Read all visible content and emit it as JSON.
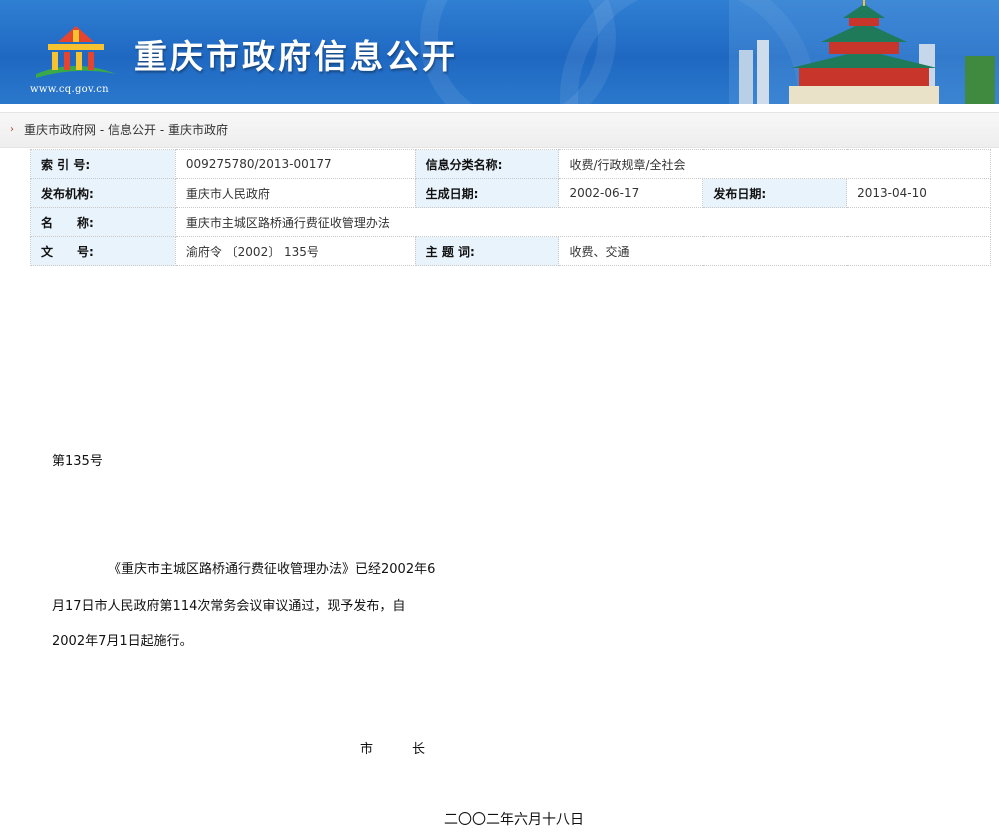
{
  "header": {
    "site_title": "重庆市政府信息公开",
    "logo_url": "www.cq.gov.cn"
  },
  "breadcrumb": {
    "items": [
      "重庆市政府网",
      "信息公开",
      "重庆市政府"
    ],
    "separator": " - "
  },
  "meta": {
    "index_label": "索 引 号:",
    "index_value": "009275780/2013-00177",
    "category_label": "信息分类名称:",
    "category_value": "收费/行政规章/全社会",
    "publisher_label": "发布机构:",
    "publisher_value": "重庆市人民政府",
    "created_label": "生成日期:",
    "created_value": "2002-06-17",
    "published_label": "发布日期:",
    "published_value": "2013-04-10",
    "name_label": "名　　称:",
    "name_value": "重庆市主城区路桥通行费征收管理办法",
    "docno_label": "文　　号:",
    "docno_value": "渝府令 〔2002〕 135号",
    "subject_label": "主 题 词:",
    "subject_value": "收费、交通"
  },
  "document": {
    "order_no": "第135号",
    "para_line1": "《重庆市主城区路桥通行费征收管理办法》已经2002年6",
    "para_line2": "月17日市人民政府第114次常务会议审议通过，现予发布，自",
    "para_line3": "2002年7月1日起施行。",
    "signer": "市　　　长",
    "date": "二〇〇二年六月十八日"
  },
  "colors": {
    "banner_blue": "#1f68c2",
    "table_label_bg": "#e9f3fb"
  }
}
